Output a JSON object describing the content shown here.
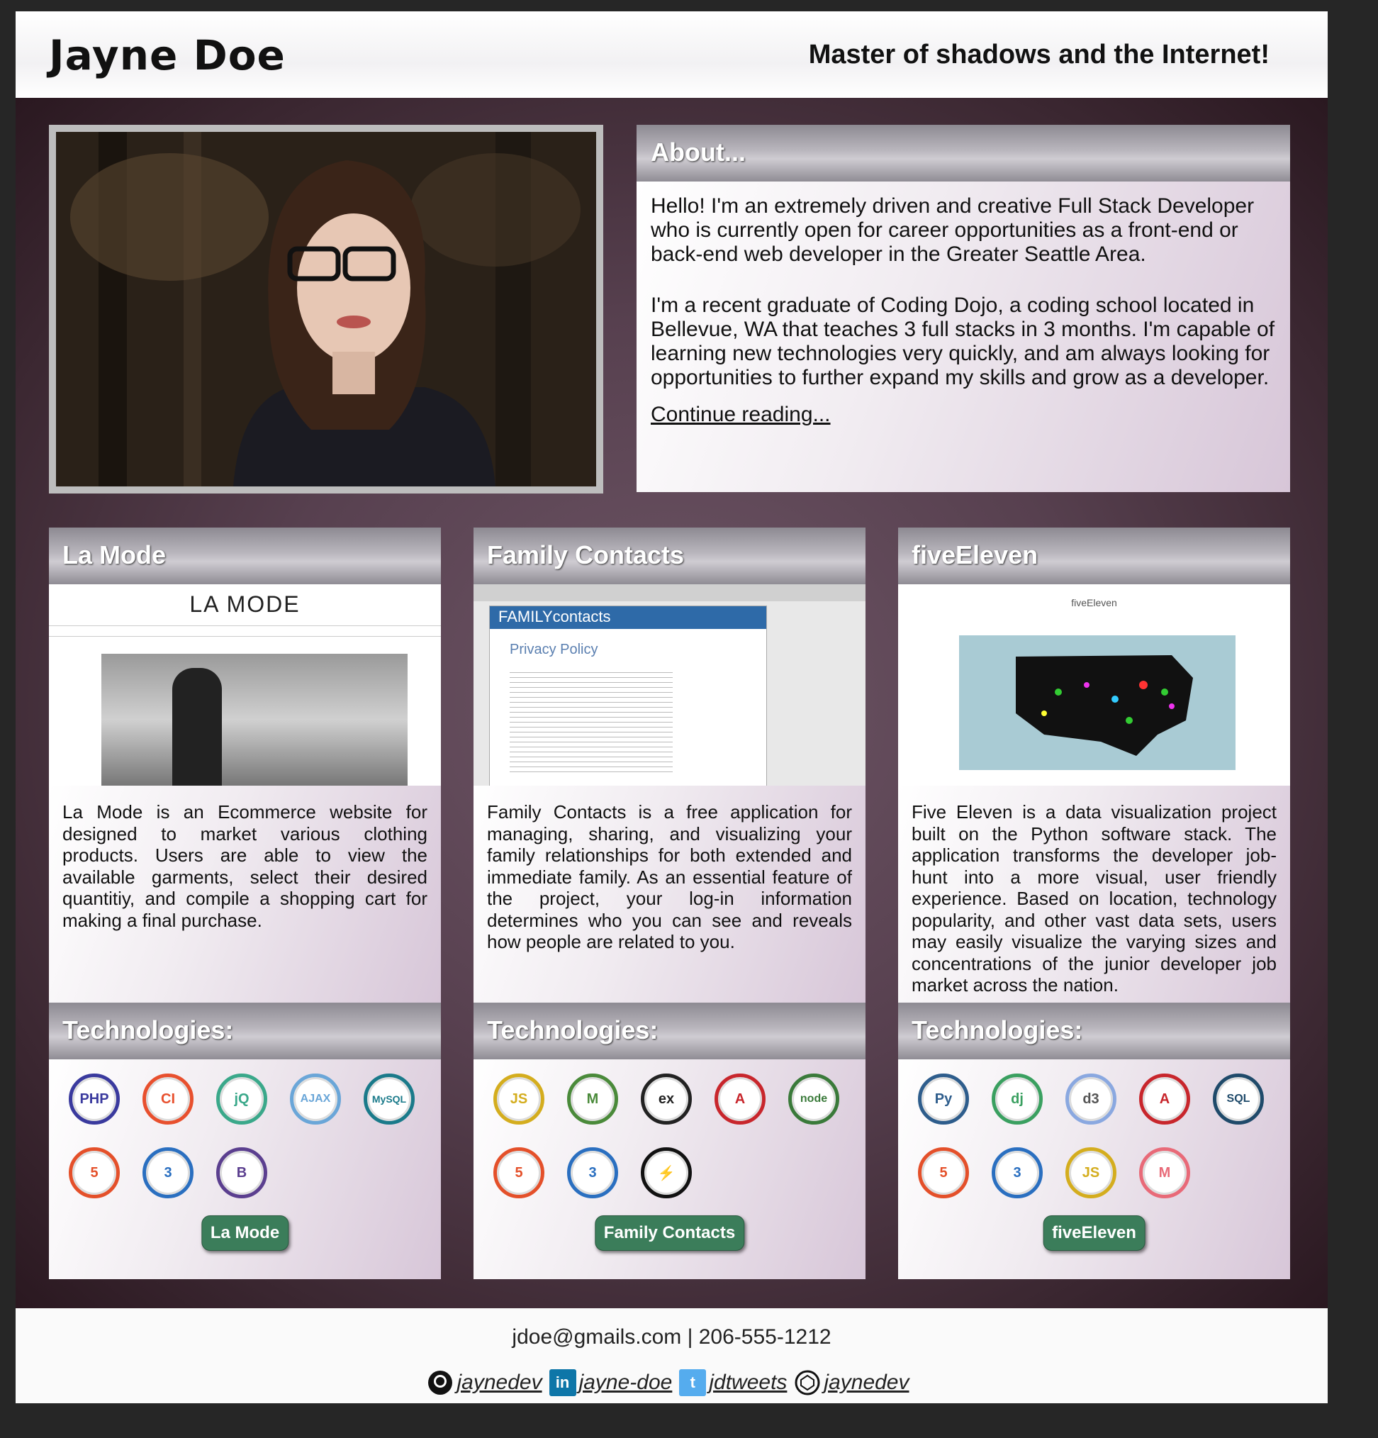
{
  "header": {
    "name": "Jayne Doe",
    "tagline": "Master of shadows and the Internet!"
  },
  "about": {
    "title": "About...",
    "paragraph1": "Hello! I'm an extremely driven and creative Full Stack Developer who is currently open for career opportunities as a front-end or back-end web developer in the Greater Seattle Area.",
    "paragraph2": "I'm a recent graduate of Coding Dojo, a coding school located in Bellevue, WA that teaches 3 full stacks in 3 months. I'm capable of learning new technologies very quickly, and am always looking for opportunities to further expand my skills and grow as a developer.",
    "link": "Continue reading..."
  },
  "projects": [
    {
      "title": "La Mode",
      "screenshot_heading": "LA MODE",
      "description": "La Mode is an Ecommerce website for designed to market various clothing products. Users are able to view the available garments, select their desired quantitiy, and compile a shopping cart for making a final purchase.",
      "tech_title": "Technologies:",
      "button": "La Mode",
      "tech": [
        {
          "label": "PHP",
          "icon": "php-icon",
          "color": "#3a3a9e"
        },
        {
          "label": "CI",
          "icon": "codeigniter-icon",
          "color": "#e8502e"
        },
        {
          "label": "jQ",
          "icon": "jquery-icon",
          "color": "#3aa88a"
        },
        {
          "label": "AJAX",
          "icon": "ajax-icon",
          "color": "#6aa6d8"
        },
        {
          "label": "MySQL",
          "icon": "mysql-icon",
          "color": "#1a7a8a"
        },
        {
          "label": "5",
          "icon": "html5-icon",
          "color": "#e4502a"
        },
        {
          "label": "3",
          "icon": "css3-icon",
          "color": "#2a6fc0"
        },
        {
          "label": "B",
          "icon": "bootstrap-icon",
          "color": "#5b3f8f"
        }
      ]
    },
    {
      "title": "Family Contacts",
      "screenshot_heading": "FAMILYcontacts",
      "screenshot_subheading": "Privacy Policy",
      "description": "Family Contacts is a free application for managing, sharing, and visualizing your family relationships for both extended and immediate family. As an essential feature of the project, your log-in information determines who you can see and reveals how people are related to you.",
      "tech_title": "Technologies:",
      "button": "Family Contacts",
      "tech": [
        {
          "label": "JS",
          "icon": "javascript-icon",
          "color": "#d4ad1e"
        },
        {
          "label": "M",
          "icon": "mongodb-icon",
          "color": "#4a8a3a"
        },
        {
          "label": "ex",
          "icon": "express-icon",
          "color": "#222222"
        },
        {
          "label": "A",
          "icon": "angular-icon",
          "color": "#c8262c"
        },
        {
          "label": "node",
          "icon": "nodejs-icon",
          "color": "#3a7a3a"
        },
        {
          "label": "5",
          "icon": "html5-icon",
          "color": "#e4502a"
        },
        {
          "label": "3",
          "icon": "css3-icon",
          "color": "#2a6fc0"
        },
        {
          "label": "⚡",
          "icon": "socketio-icon",
          "color": "#111111"
        }
      ]
    },
    {
      "title": "fiveEleven",
      "screenshot_heading": "fiveEleven",
      "description": "Five Eleven is a data visualization project built on the Python software stack. The application transforms the developer job-hunt into a more visual, user friendly experience. Based on location, technology popularity, and other vast data sets, users may easily visualize the varying sizes and concentrations of the junior developer job market across the nation.",
      "tech_title": "Technologies:",
      "button": "fiveEleven",
      "tech": [
        {
          "label": "Py",
          "icon": "python-icon",
          "color": "#2e5d8c"
        },
        {
          "label": "dj",
          "icon": "django-icon",
          "color": "#3aa060"
        },
        {
          "label": "d3",
          "icon": "d3js-icon",
          "color": "#8aa8e0"
        },
        {
          "label": "A",
          "icon": "angular-icon",
          "color": "#c8262c"
        },
        {
          "label": "SQL",
          "icon": "sqlite-icon",
          "color": "#1f4a6a"
        },
        {
          "label": "5",
          "icon": "html5-icon",
          "color": "#e4502a"
        },
        {
          "label": "3",
          "icon": "css3-icon",
          "color": "#2a6fc0"
        },
        {
          "label": "JS",
          "icon": "javascript-icon",
          "color": "#d4ad1e"
        },
        {
          "label": "M",
          "icon": "materialize-icon",
          "color": "#e86a78"
        }
      ]
    }
  ],
  "footer": {
    "contact": "jdoe@gmails.com | 206-555-1212",
    "socials": [
      {
        "icon": "github-icon",
        "label": "jaynedev"
      },
      {
        "icon": "linkedin-icon",
        "label": "jayne-doe"
      },
      {
        "icon": "twitter-icon",
        "label": "jdtweets"
      },
      {
        "icon": "codepen-icon",
        "label": "jaynedev"
      }
    ]
  }
}
